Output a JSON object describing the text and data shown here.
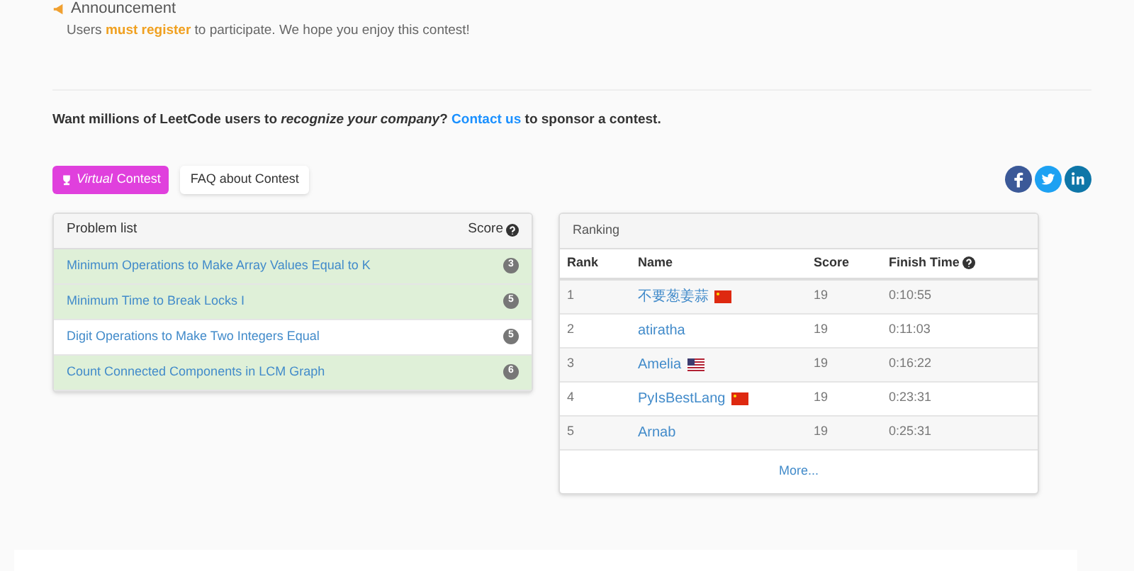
{
  "announcement": {
    "title": "Announcement",
    "text": "Users **must register** to participate. We hope you enjoy this contest!"
  },
  "sponsor": {
    "before": "Want millions of LeetCode users to *recognize your company*?",
    "link": "Contact us",
    "after": "to sponsor a contest."
  },
  "buttons": [
    {
      "label": "Virtual Contest",
      "kind": "virtual"
    },
    {
      "label": "FAQ about Contest",
      "kind": "plain"
    }
  ],
  "problems": {
    "title": "Problem list",
    "score_header": "Score",
    "rows": [
      {
        "title": "Minimum Operations to Make Array Values Equal to K",
        "score": "3",
        "solved": true
      },
      {
        "title": "Minimum Time to Break Locks I",
        "score": "5",
        "solved": true
      },
      {
        "title": "Digit Operations to Make Two Integers Equal",
        "score": "5",
        "solved": false
      },
      {
        "title": "Count Connected Components in LCM Graph",
        "score": "6",
        "solved": true
      }
    ]
  },
  "ranking": {
    "title": "Ranking",
    "columns": [
      "Rank",
      "Name",
      "Score",
      "Finish Time"
    ],
    "rows": [
      {
        "rank": "1",
        "name": "不要葱姜蒜",
        "kind": "china",
        "score": "19",
        "time": "0:10:55"
      },
      {
        "rank": "2",
        "name": "atiratha",
        "kind": "plain",
        "score": "19",
        "time": "0:11:03"
      },
      {
        "rank": "3",
        "name": "Amelia",
        "kind": "usa",
        "score": "19",
        "time": "0:16:22"
      },
      {
        "rank": "4",
        "name": "PyIsBestLang",
        "kind": "china",
        "score": "19",
        "time": "0:23:31"
      },
      {
        "rank": "5",
        "name": "Arnab",
        "kind": "plain",
        "score": "19",
        "time": "0:25:31"
      }
    ],
    "more": "More..."
  }
}
